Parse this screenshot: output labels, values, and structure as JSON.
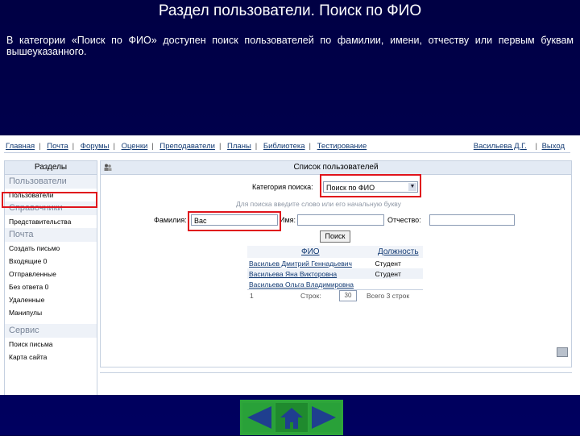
{
  "slide": {
    "title": "Раздел пользователи. Поиск по ФИО",
    "description": "В категории «Поиск по ФИО» доступен поиск пользователей по фамилии, имени, отчеству или первым буквам вышеуказанного."
  },
  "topnav": {
    "links": [
      "Главная",
      "Почта",
      "Форумы",
      "Оценки",
      "Преподаватели",
      "Планы",
      "Библиотека",
      "Тестирование"
    ],
    "user": "Васильева Д.Г.",
    "exit": "Выход"
  },
  "sidebar": {
    "header": "Разделы",
    "sections": [
      {
        "title": "Пользователи",
        "items": [
          "Пользователи"
        ]
      },
      {
        "title": "Справочники",
        "items": [
          "Представительства"
        ]
      },
      {
        "title": "Почта",
        "items": [
          "Создать письмо",
          "Входящие 0",
          "Отправленные",
          "Без ответа 0",
          "Удаленные",
          "Манипулы"
        ]
      },
      {
        "title": "Сервис",
        "items": [
          "Поиск письма",
          "Карта сайта"
        ]
      }
    ]
  },
  "main": {
    "header": "Список пользователей",
    "category_label": "Категория поиска:",
    "category_value": "Поиск по ФИО",
    "hint": "Для поиска введите слово или его начальную букву",
    "surname_label": "Фамилия:",
    "surname_value": "Вас",
    "name_label": "Имя:",
    "name_value": "",
    "patronymic_label": "Отчество:",
    "patronymic_value": "",
    "search_button": "Поиск",
    "columns": [
      "ФИО",
      "Должность"
    ],
    "rows": [
      {
        "fio": "Васильев Дмитрий Геннадьевич",
        "role": "Студент"
      },
      {
        "fio": "Васильева Яна Викторовна",
        "role": "Студент"
      },
      {
        "fio": "Васильева Ольга Владимировна",
        "role": ""
      }
    ],
    "pager": {
      "page": "1",
      "rows_label": "Строк:",
      "rows_value": "30",
      "total": "Всего 3 строк"
    }
  },
  "colors": {
    "highlight": "#e0141c",
    "nav_green": "#2da53a",
    "link": "#123a73"
  },
  "nav_buttons": [
    "prev-arrow-icon",
    "home-icon",
    "next-arrow-icon"
  ]
}
